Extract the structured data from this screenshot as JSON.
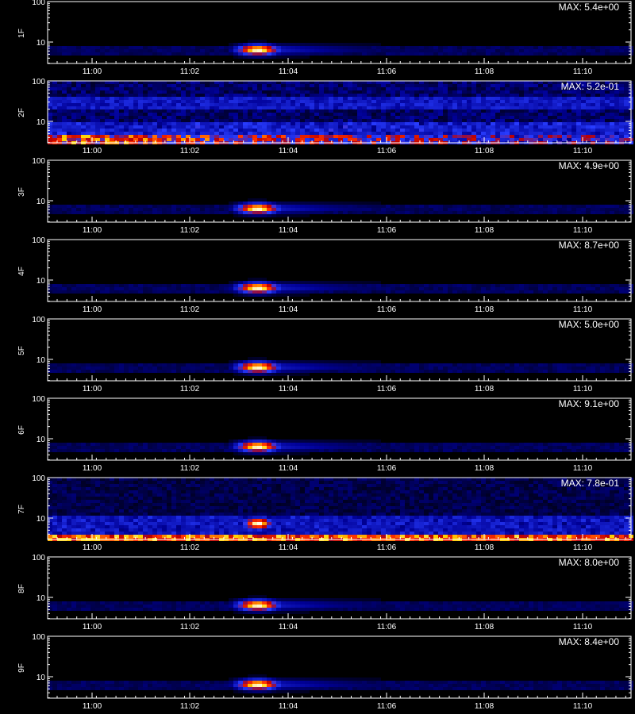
{
  "chart_data": {
    "type": "heatmap",
    "x_ticks": [
      "11:00",
      "11:02",
      "11:04",
      "11:06",
      "11:08",
      "11:10"
    ],
    "y_ticks": [
      "10",
      "100"
    ],
    "y_scale": "log",
    "colormap": [
      "#000000",
      "#00009c",
      "#3040ff",
      "#c00000",
      "#ff3000",
      "#ffd000",
      "#ffffff"
    ],
    "panels": [
      {
        "label": "1F",
        "max": "MAX: 5.4e+00",
        "kind": "burst"
      },
      {
        "label": "2F",
        "max": "MAX: 5.2e-01",
        "kind": "noisy"
      },
      {
        "label": "3F",
        "max": "MAX: 4.9e+00",
        "kind": "burst"
      },
      {
        "label": "4F",
        "max": "MAX: 8.7e+00",
        "kind": "burst"
      },
      {
        "label": "5F",
        "max": "MAX: 5.0e+00",
        "kind": "burst"
      },
      {
        "label": "6F",
        "max": "MAX: 9.1e+00",
        "kind": "burst"
      },
      {
        "label": "7F",
        "max": "MAX: 7.8e-01",
        "kind": "noisy-burst"
      },
      {
        "label": "8F",
        "max": "MAX: 8.0e+00",
        "kind": "burst"
      },
      {
        "label": "9F",
        "max": "MAX: 8.4e+00",
        "kind": "burst"
      }
    ]
  }
}
